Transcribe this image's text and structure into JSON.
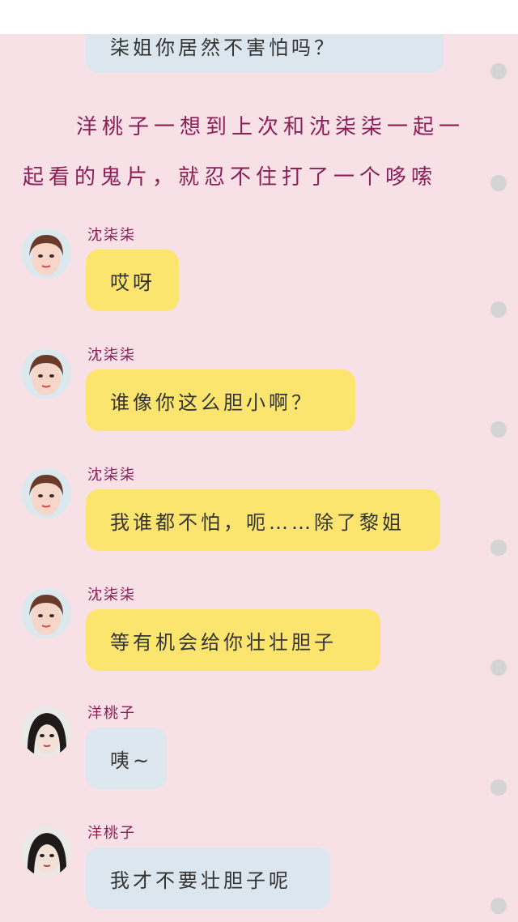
{
  "top_bubble": {
    "text": "柒姐你居然不害怕吗？"
  },
  "narration": {
    "line1": "洋桃子一想到上次和沈柒柒一起一",
    "line2": "起看的鬼片，就忍不住打了一个哆嗦"
  },
  "messages": [
    {
      "sender": "沈柒柒",
      "text": "哎呀",
      "style": "yellow"
    },
    {
      "sender": "沈柒柒",
      "text": "谁像你这么胆小啊？",
      "style": "yellow"
    },
    {
      "sender": "沈柒柒",
      "text": "我谁都不怕，呃……除了黎姐",
      "style": "yellow"
    },
    {
      "sender": "沈柒柒",
      "text": "等有机会给你壮壮胆子",
      "style": "yellow"
    },
    {
      "sender": "洋桃子",
      "text": "咦~",
      "style": "blue"
    },
    {
      "sender": "洋桃子",
      "text": "我才不要壮胆子呢",
      "style": "blue"
    }
  ],
  "colors": {
    "background": "#f8e0e7",
    "narration": "#8b1f57",
    "bubble_yellow": "#fce56e",
    "bubble_blue": "#dbe6ee",
    "scroll_dot": "#d4d4d4"
  },
  "icons": {
    "avatar_1": "avatar-shen-qiqi",
    "avatar_2": "avatar-yang-taozi",
    "scroll_marker": "scroll-dot-icon"
  }
}
